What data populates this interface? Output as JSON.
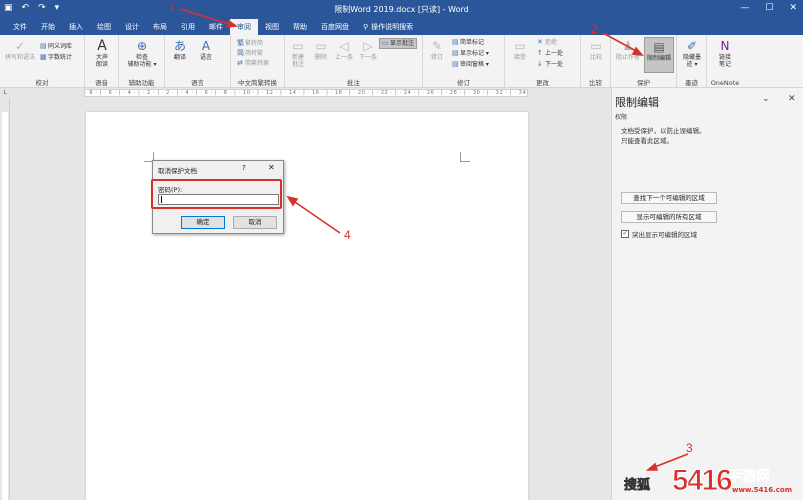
{
  "titlebar": {
    "title": "限制Word 2019.docx [只读] - Word",
    "qa_icons": [
      "save-icon",
      "undo-icon",
      "redo-icon",
      "customize-icon"
    ],
    "save_glyph": "▣",
    "undo_glyph": "↶",
    "redo_glyph": "↷",
    "more_glyph": "▾",
    "min_glyph": "—",
    "max_glyph": "☐",
    "close_glyph": "✕"
  },
  "tabs": [
    "文件",
    "开始",
    "插入",
    "绘图",
    "设计",
    "布局",
    "引用",
    "邮件",
    "审阅",
    "视图",
    "帮助",
    "百度网盘"
  ],
  "tell_me": "操作说明搜索",
  "ribbon": {
    "proofing": {
      "label": "校对",
      "spell": "拼写和语法",
      "thesaurus": "同义词库",
      "wordcount": "字数统计"
    },
    "speech": {
      "label": "语音",
      "readaloud_line1": "大声",
      "readaloud_line2": "朗读"
    },
    "accessibility": {
      "label": "辅助功能",
      "check_line1": "检查",
      "check_line2": "辅助功能 ▾"
    },
    "language": {
      "label": "语言",
      "translate": "翻译",
      "language": "语言"
    },
    "chinese": {
      "label": "中文简繁转换",
      "to_trad": "繁转简",
      "to_simp": "简转繁",
      "convert": "简繁转换"
    },
    "comments": {
      "label": "批注",
      "new_line1": "新建",
      "new_line2": "批注",
      "delete": "删除",
      "prev": "上一条",
      "next": "下一条",
      "show": "显示批注"
    },
    "tracking": {
      "label": "修订",
      "track": "修订",
      "markup": "简单标记",
      "showmarkup": "显示标记 ▾",
      "pane": "审阅窗格 ▾"
    },
    "changes": {
      "label": "更改",
      "accept": "接受",
      "reject": "拒绝",
      "prev": "上一处",
      "next": "下一处"
    },
    "compare": {
      "label": "比较",
      "compare": "比较"
    },
    "protect": {
      "label": "保护",
      "block_line1": "阻止作者",
      "restrict_line1": "限制编辑"
    },
    "ink": {
      "label": "墨迹",
      "hide_line1": "隐藏墨",
      "hide_line2": "迹 ▾"
    },
    "onenote": {
      "label": "OneNote",
      "link_line1": "链接",
      "link_line2": "笔记"
    }
  },
  "ruler_marks": "· 8 · | · 6 · | · 4 · | · 2 · |  · 2 · | · 4 · | · 6 · | · 8 · | · 10 · | · 12 · | · 14 · | · 16 · | · 18 · | · 20 · | · 22 · | · 24 · | · 26 · | · 28 · | · 30 · | · 32 · | · 34 · | · 36 · | · 38 · | · 40 · | · 42 · | · 44 · | · 46 · | · 48 ·",
  "ruler_corner": "L",
  "dialog": {
    "title": "取消保护文档",
    "help": "?",
    "close": "✕",
    "password_label": "密码(P):",
    "password_value": "",
    "ok": "确定",
    "cancel": "取消"
  },
  "pane": {
    "title": "限制编辑",
    "dropdown": "⌄",
    "close": "✕",
    "subtitle": "权限",
    "desc_line1": "文档受保护，以防止误编辑。",
    "desc_line2": "只能查看此区域。",
    "find_next": "查找下一个可编辑的区域",
    "show_all": "显示可编辑的所有区域",
    "highlight": "突出显示可编辑的区域",
    "highlight_checked": "✓"
  },
  "annotations": {
    "n1": "1",
    "n2": "2",
    "n3": "3",
    "n4": "4",
    "color": "#d8312c"
  },
  "watermark": {
    "prefix": "搜狐",
    "logo": "5416",
    "name": "手游网",
    "url": "www.5416.com"
  }
}
